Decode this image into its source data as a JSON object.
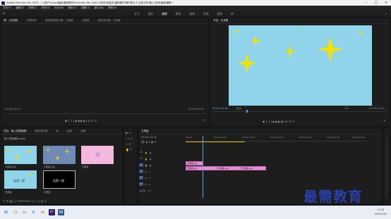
{
  "window": {
    "title": "Adobe Premiere Pro 2020 - C:\\用户\\zhou\\桌面\\最新素材\\Premiere Pro 2020 从新手到高手\\最新素材\\第9章\\8.3 大量文件\\输入\\完成\\最新编辑 *"
  },
  "menu": [
    "文件(F)",
    "编辑(E)",
    "剪辑(C)",
    "序列(S)",
    "标记(M)",
    "图形(G)",
    "视图(V)",
    "窗口(W)",
    "帮助(H)"
  ],
  "workspaces": [
    "学习",
    "组件",
    "编辑",
    "颜色",
    "效果",
    "音频",
    "图形",
    "库"
  ],
  "source_panel": {
    "tabs": [
      "源：(无剪辑)",
      "效果控件",
      "音频剪辑混合器：五角星",
      "元数据",
      "音轨混合器：五角星"
    ],
    "timecode_left": "00:00:00:00",
    "timecode_right": "00:00:00:00"
  },
  "program_panel": {
    "tab": "节目：五角星",
    "timecode_left": "00:00:03:00",
    "fit": "适合",
    "ratio": "1/2",
    "timecode_right": "00:00:10:00"
  },
  "project_panel": {
    "tabs": [
      "项目：输入视频编辑",
      "媒体浏览器",
      "库",
      "信息",
      "效果"
    ],
    "path": "输入视频编辑.prproj",
    "thumbs": [
      {
        "label": "小星星.jpg"
      },
      {
        "label": "小星星.jpg"
      },
      {
        "label": "五角星"
      },
      {
        "label": "五角星"
      },
      {
        "label": "五角星"
      }
    ],
    "thumb_text_1": "这是一段",
    "thumb_text_2": "这是一段"
  },
  "timeline": {
    "tab": "五角星",
    "timecode": "00:00:03:00",
    "ruler": [
      "00:00",
      "00:00:05:00",
      "00:00:10:00",
      "00:00:15:00",
      "00:00:20:00",
      "00:00:25:00",
      "00:00:30:00"
    ],
    "tracks": [
      "V3",
      "V2",
      "V1",
      "A1",
      "A2",
      "A3"
    ],
    "master": "主声道",
    "master_value": "0.0",
    "clips": [
      {
        "label": "五角星.jpg"
      },
      {
        "label": "五角星.jpg"
      },
      {
        "label": "小星星.jpg"
      },
      {
        "label": "五角星.jpg"
      }
    ]
  },
  "taskbar": {
    "time": "15:18",
    "date": "2022/1/20"
  },
  "watermark": "最需教育",
  "colors": {
    "frame_bg": "#8fd4ea",
    "star": "#f5e100",
    "clip": "#e58ed6",
    "accent": "#5aa7e4"
  }
}
